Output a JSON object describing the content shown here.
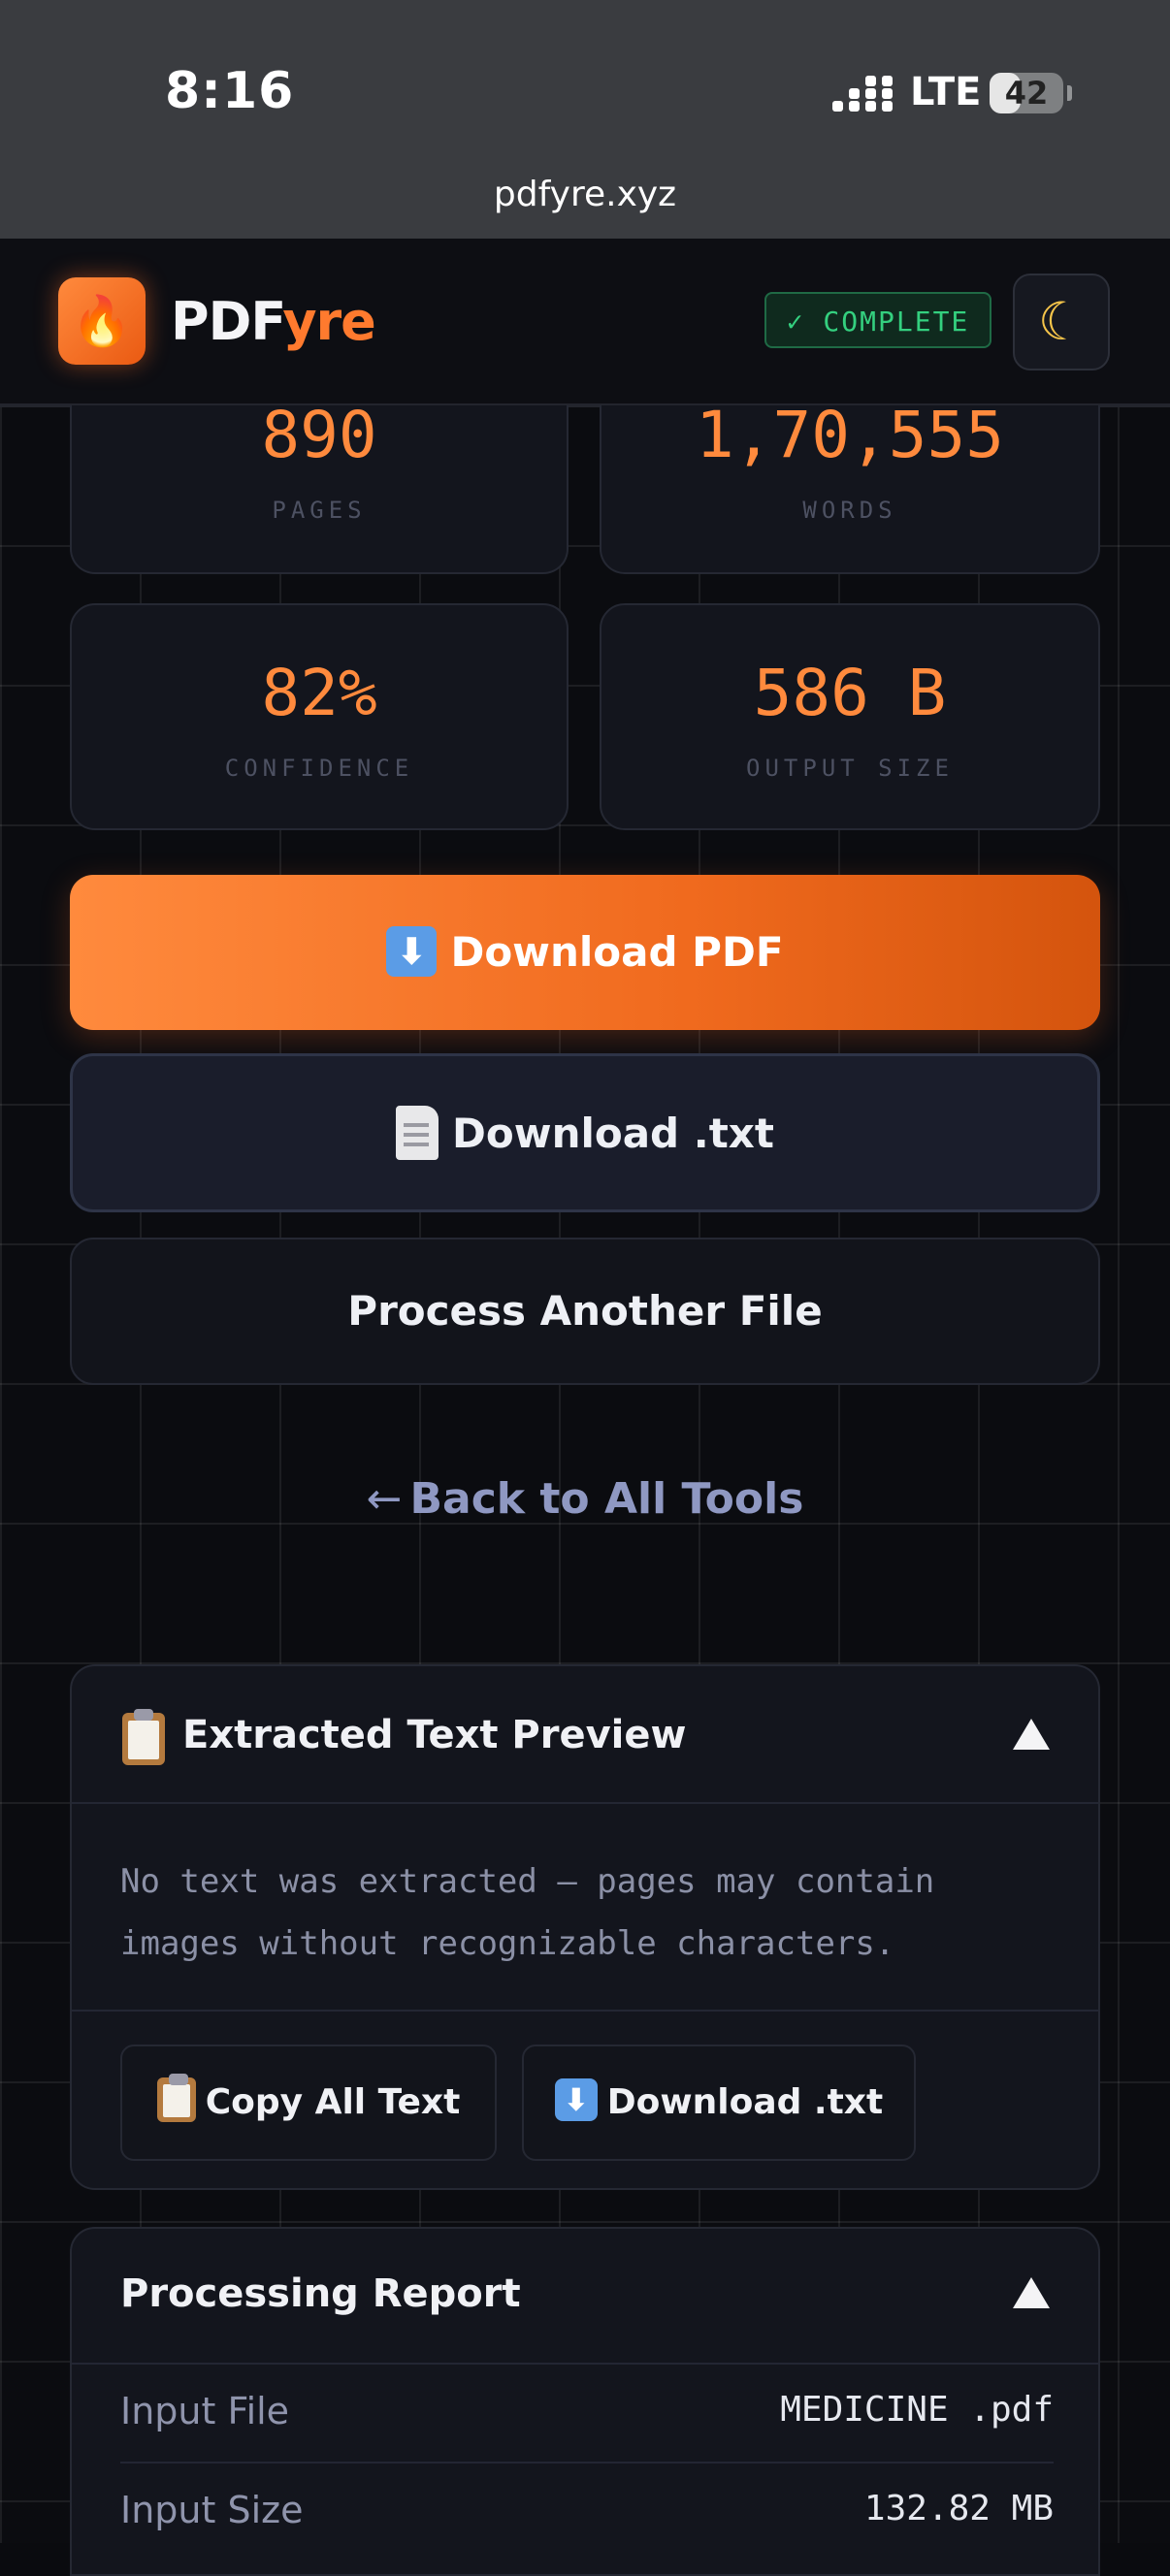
{
  "status_bar": {
    "time": "8:16",
    "network": "LTE",
    "battery": "42",
    "battery_level_percent": 42
  },
  "browser": {
    "url": "pdfyre.xyz"
  },
  "header": {
    "logo_icon": "flame-icon",
    "brand_part1": "PDF",
    "brand_part2": "yre",
    "status_badge": "✓ COMPLETE",
    "theme_icon": "moon-icon"
  },
  "stats": [
    {
      "value": "890",
      "label": "PAGES"
    },
    {
      "value": "1,70,555",
      "label": "WORDS"
    },
    {
      "value": "82%",
      "label": "CONFIDENCE"
    },
    {
      "value": "586 B",
      "label": "OUTPUT SIZE"
    }
  ],
  "actions": {
    "download_pdf": "Download PDF",
    "download_txt": "Download .txt",
    "process_another": "Process Another File",
    "back_arrow": "←",
    "back_to_tools": "Back to All Tools"
  },
  "preview": {
    "title": "Extracted Text Preview",
    "message": "No text was extracted — pages may contain images without recognizable characters.",
    "copy_label": "Copy All Text",
    "download_label": "Download .txt"
  },
  "report": {
    "title": "Processing Report",
    "rows": [
      {
        "label": "Input File",
        "value": "MEDICINE .pdf"
      },
      {
        "label": "Input Size",
        "value": "132.82 MB"
      }
    ]
  },
  "colors": {
    "accent": "#ff7a2e",
    "success": "#34d07f",
    "background": "#0a0b0f"
  }
}
